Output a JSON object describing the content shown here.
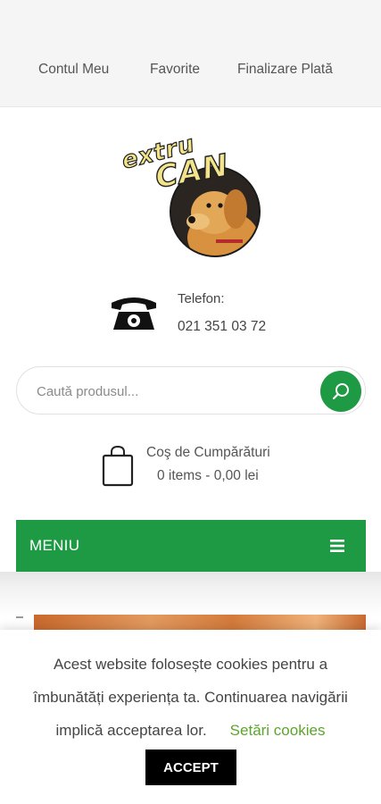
{
  "topnav": {
    "items": [
      {
        "label": "Contul Meu"
      },
      {
        "label": "Favorite"
      },
      {
        "label": "Finalizare Plată"
      }
    ]
  },
  "logo": {
    "text_top": "extru",
    "text_bottom": "CAN"
  },
  "contact": {
    "label": "Telefon:",
    "number": "021 351 03 72",
    "icon": "telephone-icon"
  },
  "search": {
    "placeholder": "Caută produsul...",
    "value": "",
    "icon": "search-icon"
  },
  "cart": {
    "title": "Coş de Cumpărături",
    "summary": "0 items - 0,00 lei",
    "icon": "shopping-bag-icon"
  },
  "menu": {
    "label": "MENIU",
    "icon": "hamburger-icon"
  },
  "cookie_banner": {
    "line1": "Acest website folosește cookies pentru a",
    "line2": "îmbunătăți experiența ta. Continuarea navigării",
    "line3": "implică acceptarea lor.",
    "settings_link": "Setări cookies",
    "accept_label": "ACCEPT"
  },
  "colors": {
    "brand_green": "#1f9a44",
    "link_green": "#5da52a",
    "topbar_bg": "#f5f5f5"
  }
}
